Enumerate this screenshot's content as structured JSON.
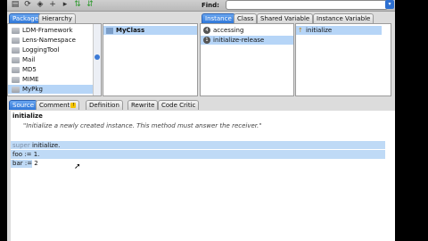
{
  "toolbar": {
    "icons": [
      "browser-icon",
      "refresh-icon",
      "tag-icon",
      "add-icon",
      "forward-icon",
      "class-green-icon",
      "method-green-icon"
    ],
    "find_label": "Find:",
    "find_value": ""
  },
  "package_tabs": [
    "Package",
    "Hierarchy"
  ],
  "packages": [
    "LDM-Framework",
    "Lens-Namespace",
    "LoggingTool",
    "Mail",
    "MD5",
    "MIME",
    "MyPkg"
  ],
  "selected_package": "MyPkg",
  "classes": [
    "MyClass"
  ],
  "class_tabs": [
    "Instance",
    "Class",
    "Shared Variable",
    "Instance Variable"
  ],
  "categories": [
    {
      "badge": "4",
      "label": "accessing"
    },
    {
      "badge": "1",
      "label": "initialize-release"
    }
  ],
  "methods": [
    "initialize"
  ],
  "editor_tabs": [
    "Source",
    "Comment",
    "Definition",
    "Rewrite",
    "Code Critic"
  ],
  "code": {
    "selector": "initialize",
    "comment": "\"Initialize a newly created instance. This method must answer the receiver.\"",
    "line1_kw": "super",
    "line1_rest": " initialize.",
    "line2": "foo := 1.",
    "line3": "bar := 2"
  }
}
